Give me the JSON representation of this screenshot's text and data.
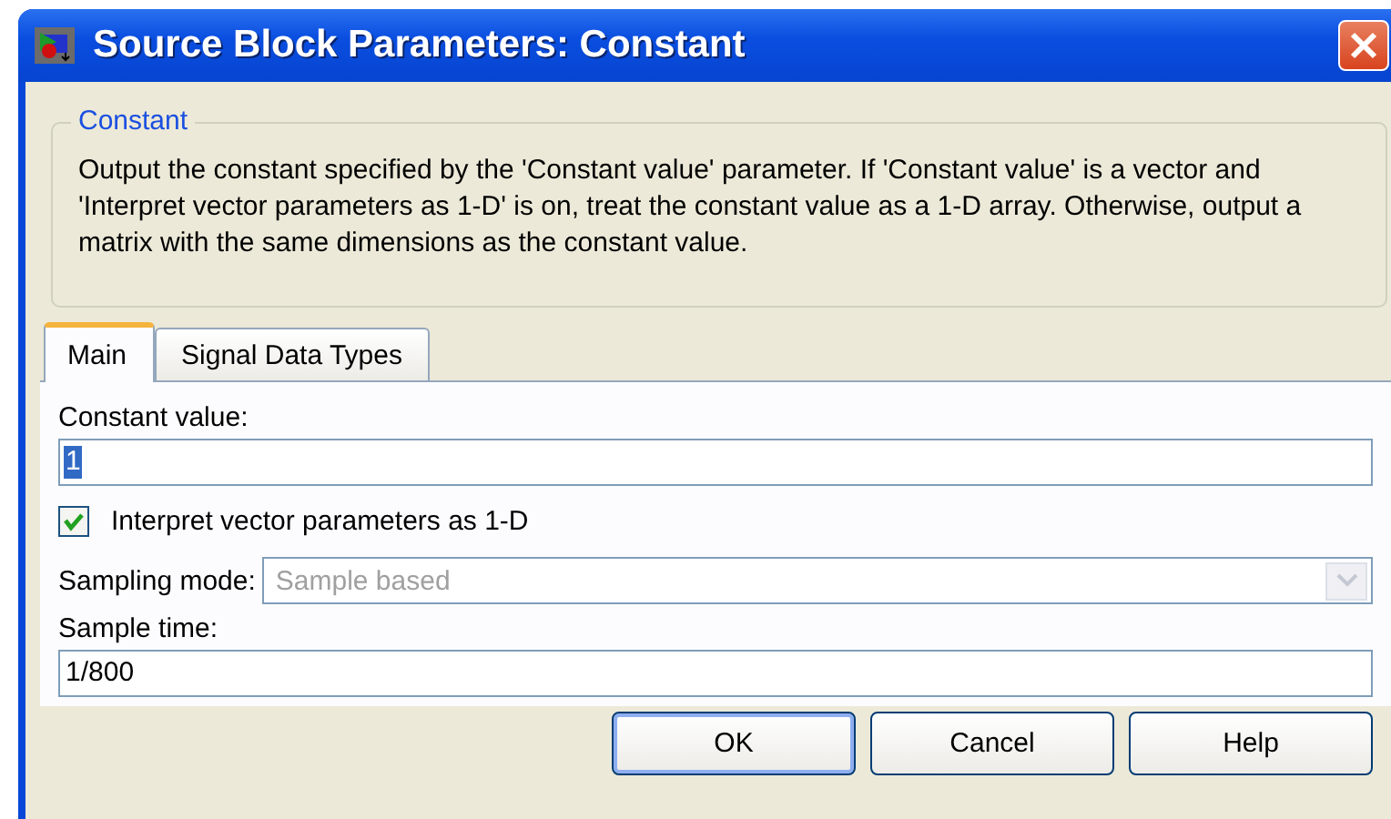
{
  "window": {
    "title": "Source Block Parameters: Constant"
  },
  "description": {
    "group_title": "Constant",
    "text": "Output the constant specified by the 'Constant value' parameter. If 'Constant value' is a vector and 'Interpret vector parameters as 1-D' is on, treat the constant value as a 1-D array. Otherwise, output a matrix with the same dimensions as the constant value."
  },
  "tabs": [
    {
      "label": "Main",
      "selected": true
    },
    {
      "label": "Signal Data Types",
      "selected": false
    }
  ],
  "parameters": [
    {
      "kind": "text",
      "label": "Constant value:",
      "value": "1",
      "text_selected": true
    },
    {
      "kind": "checkbox",
      "label": "Interpret vector parameters as 1-D",
      "checked": true
    },
    {
      "kind": "dropdown",
      "label": "Sampling mode:",
      "value": "Sample based",
      "disabled": true
    },
    {
      "kind": "text",
      "label": "Sample time:",
      "value": "1/800",
      "text_selected": false
    }
  ],
  "buttons": [
    {
      "label": "OK",
      "default": true
    },
    {
      "label": "Cancel",
      "default": false
    },
    {
      "label": "Help",
      "default": false
    }
  ]
}
